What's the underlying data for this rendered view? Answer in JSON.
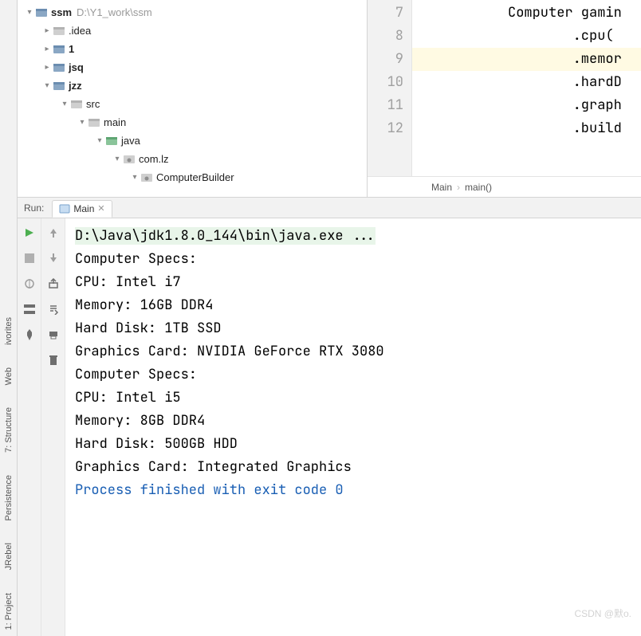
{
  "left_gutter": {
    "items": [
      "1: Project",
      "JRebel",
      "Persistence",
      "7: Structure",
      "Web",
      "ivorites"
    ]
  },
  "project_tree": {
    "root": {
      "label": "ssm",
      "path": "D:\\Y1_work\\ssm"
    },
    "children": [
      {
        "label": ".idea",
        "indent": 1,
        "chevron": "right",
        "type": "folder"
      },
      {
        "label": "1",
        "indent": 1,
        "chevron": "right",
        "type": "module",
        "bold": true
      },
      {
        "label": "jsq",
        "indent": 1,
        "chevron": "right",
        "type": "module",
        "bold": true
      },
      {
        "label": "jzz",
        "indent": 1,
        "chevron": "down",
        "type": "module",
        "bold": true
      },
      {
        "label": "src",
        "indent": 2,
        "chevron": "down",
        "type": "folder"
      },
      {
        "label": "main",
        "indent": 3,
        "chevron": "down",
        "type": "folder"
      },
      {
        "label": "java",
        "indent": 4,
        "chevron": "down",
        "type": "source"
      },
      {
        "label": "com.lz",
        "indent": 5,
        "chevron": "down",
        "type": "package"
      },
      {
        "label": "ComputerBuilder",
        "indent": 6,
        "chevron": "down",
        "type": "package"
      }
    ]
  },
  "editor": {
    "gutter": [
      "7",
      "8",
      "9",
      "10",
      "11",
      "12"
    ],
    "lines": [
      "Computer gamin",
      "        .cpu(",
      "        .memor",
      "        .hardD",
      "        .graph",
      "        .build"
    ],
    "highlight_index": 2,
    "breadcrumb": [
      "Main",
      "main()"
    ]
  },
  "run": {
    "label": "Run:",
    "tab": "Main",
    "command": "D:\\Java\\jdk1.8.0_144\\bin\\java.exe ...",
    "output": [
      "Computer Specs:",
      "CPU: Intel i7",
      "Memory: 16GB DDR4",
      "Hard Disk: 1TB SSD",
      "Graphics Card: NVIDIA GeForce RTX 3080",
      "Computer Specs:",
      "CPU: Intel i5",
      "Memory: 8GB DDR4",
      "Hard Disk: 500GB HDD",
      "Graphics Card: Integrated Graphics"
    ],
    "exit": "Process finished with exit code 0"
  },
  "watermark": "CSDN @默o."
}
